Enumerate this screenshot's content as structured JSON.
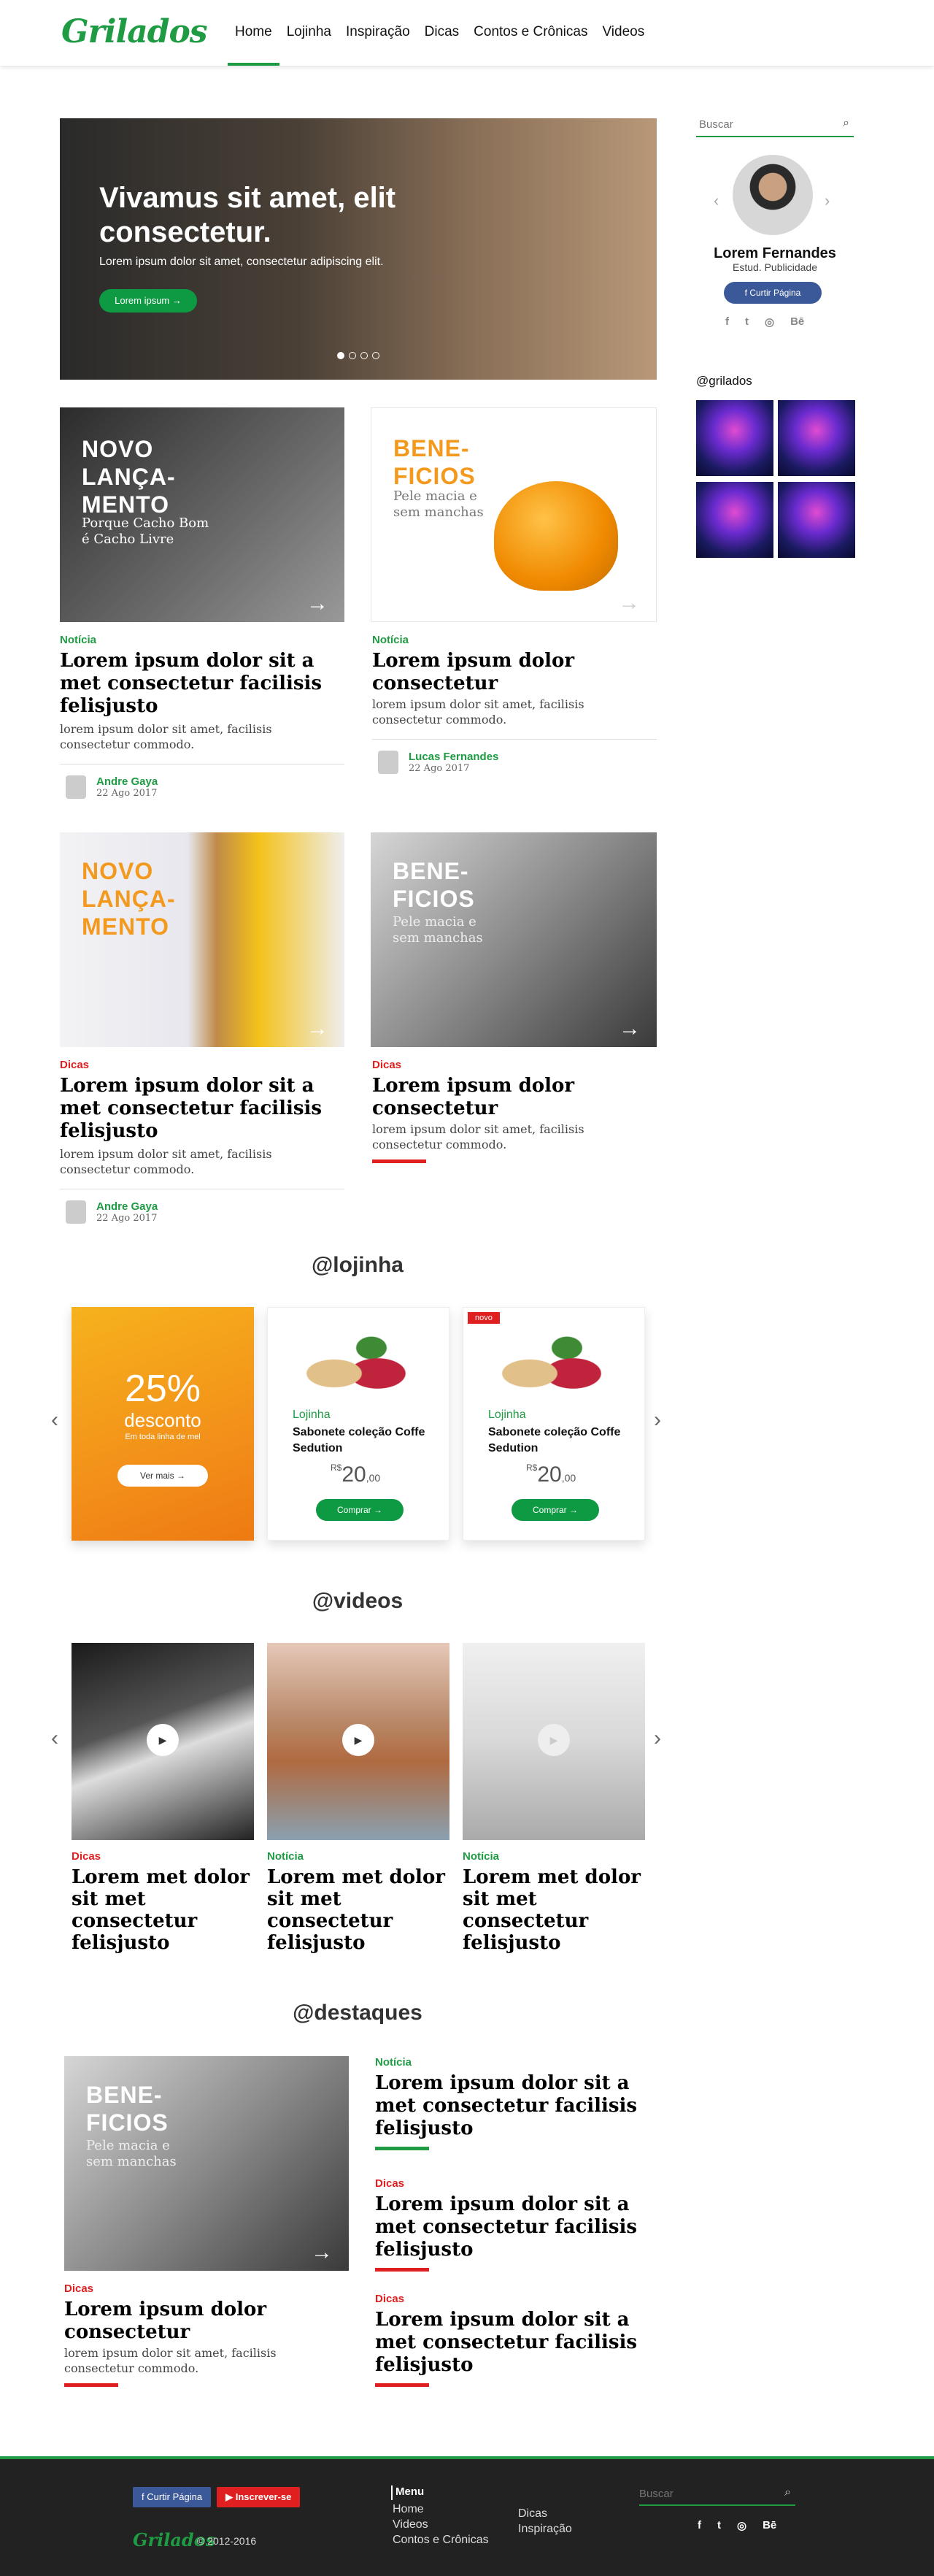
{
  "header": {
    "logo": "Grilados",
    "nav": [
      "Home",
      "Lojinha",
      "Inspiração",
      "Dicas",
      "Contos e Crônicas",
      "Videos"
    ]
  },
  "hero": {
    "title": "Vivamus sit amet, elit consectetur.",
    "subtitle": "Lorem ipsum dolor sit amet, consectetur adipiscing elit.",
    "button": "Lorem ipsum →"
  },
  "sidebar": {
    "search_placeholder": "Buscar",
    "name": "Lorem Fernandes",
    "role": "Estud. Publicidade",
    "like": "Curtir Página",
    "social": [
      "f",
      "t",
      "◎",
      "Bē"
    ],
    "insta_handle": "@grilados"
  },
  "posts": [
    {
      "overlay": "NOVO LANÇA- MENTO",
      "overlay_sub": "Porque Cacho Bom é Cacho Livre",
      "cat": "Notícia",
      "title": "Lorem ipsum dolor sit a met consectetur facilisis felisjusto",
      "excerpt": "lorem ipsum dolor sit amet, facilisis consectetur commodo.",
      "author": "Andre Gaya",
      "date": "22 Ago 2017"
    },
    {
      "overlay": "BENE- FICIOS",
      "overlay_sub": "Pele macia e sem manchas",
      "cat": "Notícia",
      "title": "Lorem ipsum dolor consectetur",
      "excerpt": "lorem ipsum dolor sit amet, facilisis consectetur commodo.",
      "author": "Lucas Fernandes",
      "date": "22 Ago 2017"
    },
    {
      "overlay": "NOVO LANÇA- MENTO",
      "cat": "Dicas",
      "title": "Lorem ipsum dolor sit a met consectetur facilisis felisjusto",
      "excerpt": "lorem ipsum dolor sit amet, facilisis consectetur commodo.",
      "author": "Andre Gaya",
      "date": "22 Ago 2017"
    },
    {
      "overlay": "BENE- FICIOS",
      "overlay_sub": "Pele macia e sem manchas",
      "cat": "Dicas",
      "title": "Lorem ipsum dolor consectetur",
      "excerpt": "lorem ipsum dolor sit amet, facilisis consectetur commodo."
    }
  ],
  "lojinha": {
    "heading": "@lojinha",
    "promo_pct": "25%",
    "promo_word": "desconto",
    "promo_sub": "Em toda linha de mel",
    "promo_btn": "Ver mais →",
    "products": [
      {
        "cat": "Lojinha",
        "name": "Sabonete coleção Coffe Sedution",
        "cur": "R$",
        "price": "20",
        "cents": ",00",
        "btn": "Comprar →"
      },
      {
        "badge": "novo",
        "cat": "Lojinha",
        "name": "Sabonete coleção Coffe Sedution",
        "cur": "R$",
        "price": "20",
        "cents": ",00",
        "btn": "Comprar →"
      }
    ]
  },
  "videos": {
    "heading": "@videos",
    "items": [
      {
        "cat": "Dicas",
        "title": "Lorem met dolor sit met consectetur felisjusto"
      },
      {
        "cat": "Notícia",
        "title": "Lorem met dolor sit met consectetur felisjusto"
      },
      {
        "cat": "Notícia",
        "title": "Lorem met dolor sit met consectetur felisjusto"
      }
    ]
  },
  "destaques": {
    "heading": "@destaques",
    "main": {
      "overlay": "BENE- FICIOS",
      "overlay_sub": "Pele macia e sem manchas",
      "cat": "Dicas",
      "title": "Lorem ipsum dolor consectetur",
      "excerpt": "lorem ipsum dolor sit amet, facilisis consectetur commodo."
    },
    "list": [
      {
        "cat": "Notícia",
        "title": "Lorem ipsum dolor sit a met consectetur facilisis felisjusto"
      },
      {
        "cat": "Dicas",
        "title": "Lorem ipsum dolor sit a met consectetur facilisis felisjusto"
      },
      {
        "cat": "Dicas",
        "title": "Lorem ipsum dolor sit a met consectetur facilisis felisjusto"
      }
    ]
  },
  "footer": {
    "like": "Curtir Página",
    "subscribe": "Inscrever-se",
    "logo": "Grilados",
    "copyright": "© 2012-2016",
    "menu_title": "Menu",
    "menu": [
      "Home",
      "Videos",
      "Contos e Crônicas",
      "Dicas",
      "Inspiração"
    ],
    "search_placeholder": "Buscar"
  }
}
